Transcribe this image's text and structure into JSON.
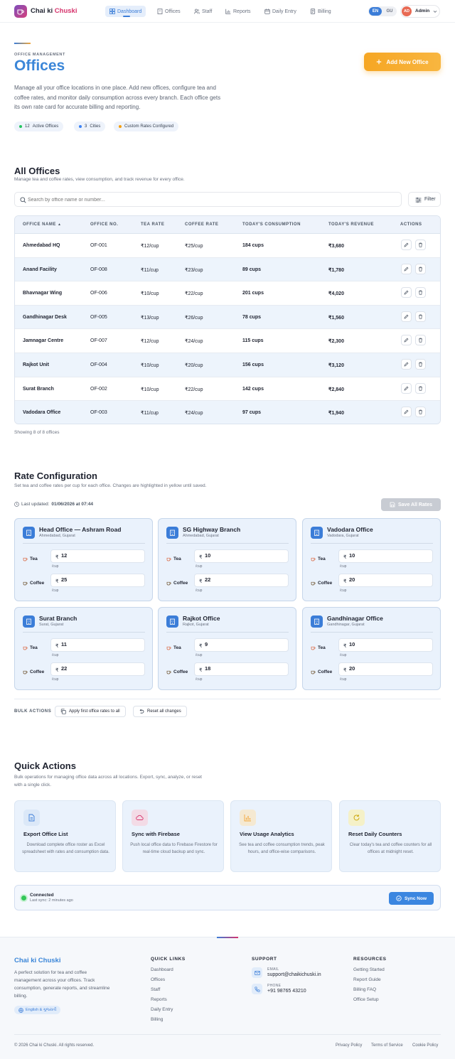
{
  "nav": {
    "brand_part1": "Chai ki",
    "brand_part2": "Chuski",
    "items": [
      {
        "label": "Dashboard",
        "icon": "grid-icon",
        "active": true
      },
      {
        "label": "Offices",
        "icon": "building-icon"
      },
      {
        "label": "Staff",
        "icon": "users-icon"
      },
      {
        "label": "Reports",
        "icon": "chart-icon"
      },
      {
        "label": "Daily Entry",
        "icon": "calendar-icon"
      },
      {
        "label": "Billing",
        "icon": "receipt-icon"
      }
    ],
    "lang_en": "EN",
    "lang_gu": "GU",
    "avatar_initials": "AD",
    "user_name": "Admin"
  },
  "hero": {
    "eyebrow": "OFFICE MANAGEMENT",
    "title": "Offices",
    "description": "Manage all your office locations in one place. Add new offices, configure tea and coffee rates, and monitor daily consumption across every branch. Each office gets its own rate card for accurate billing and reporting.",
    "chips": [
      {
        "value": "12",
        "label": "Active Offices",
        "color": "#22c55e"
      },
      {
        "value": "3",
        "label": "Cities",
        "color": "#3b82f6"
      },
      {
        "value": "",
        "label": "Custom Rates Configured",
        "color": "#f59e0b"
      }
    ],
    "add_button": "Add New Office"
  },
  "offices": {
    "title": "All Offices",
    "subtitle": "Manage tea and coffee rates, view consumption, and track revenue for every office.",
    "search_placeholder": "Search by office name or number...",
    "filter_label": "Filter",
    "columns": [
      "OFFICE NAME",
      "OFFICE NO.",
      "TEA RATE",
      "COFFEE RATE",
      "TODAY'S CONSUMPTION",
      "TODAY'S REVENUE",
      "ACTIONS"
    ],
    "rows": [
      {
        "name": "Ahmedabad HQ",
        "no": "OF-001",
        "tea": "₹12/cup",
        "coffee": "₹25/cup",
        "consumption": "184 cups",
        "revenue": "₹3,680"
      },
      {
        "name": "Anand Facility",
        "no": "OF-008",
        "tea": "₹11/cup",
        "coffee": "₹23/cup",
        "consumption": "89 cups",
        "revenue": "₹1,780"
      },
      {
        "name": "Bhavnagar Wing",
        "no": "OF-006",
        "tea": "₹10/cup",
        "coffee": "₹22/cup",
        "consumption": "201 cups",
        "revenue": "₹4,020"
      },
      {
        "name": "Gandhinagar Desk",
        "no": "OF-005",
        "tea": "₹13/cup",
        "coffee": "₹26/cup",
        "consumption": "78 cups",
        "revenue": "₹1,560"
      },
      {
        "name": "Jamnagar Centre",
        "no": "OF-007",
        "tea": "₹12/cup",
        "coffee": "₹24/cup",
        "consumption": "115 cups",
        "revenue": "₹2,300"
      },
      {
        "name": "Rajkot Unit",
        "no": "OF-004",
        "tea": "₹10/cup",
        "coffee": "₹20/cup",
        "consumption": "156 cups",
        "revenue": "₹3,120"
      },
      {
        "name": "Surat Branch",
        "no": "OF-002",
        "tea": "₹10/cup",
        "coffee": "₹22/cup",
        "consumption": "142 cups",
        "revenue": "₹2,840"
      },
      {
        "name": "Vadodara Office",
        "no": "OF-003",
        "tea": "₹11/cup",
        "coffee": "₹24/cup",
        "consumption": "97 cups",
        "revenue": "₹1,940"
      }
    ],
    "showing": "Showing 8 of 8 offices"
  },
  "rates": {
    "title": "Rate Configuration",
    "subtitle": "Set tea and coffee rates per cup for each office. Changes are highlighted in yellow until saved.",
    "last_updated_label": "Last updated:",
    "last_updated_value": "01/06/2026 at 07:44",
    "save_button": "Save All Rates",
    "tea_label": "Tea",
    "coffee_label": "Coffee",
    "currency": "₹",
    "unit": "/cup",
    "cards": [
      {
        "name": "Head Office — Ashram Road",
        "location": "Ahmedabad, Gujarat",
        "tea": "12",
        "coffee": "25"
      },
      {
        "name": "SG Highway Branch",
        "location": "Ahmedabad, Gujarat",
        "tea": "10",
        "coffee": "22"
      },
      {
        "name": "Vadodara Office",
        "location": "Vadodara, Gujarat",
        "tea": "10",
        "coffee": "20"
      },
      {
        "name": "Surat Branch",
        "location": "Surat, Gujarat",
        "tea": "11",
        "coffee": "22"
      },
      {
        "name": "Rajkot Office",
        "location": "Rajkot, Gujarat",
        "tea": "9",
        "coffee": "18"
      },
      {
        "name": "Gandhinagar Office",
        "location": "Gandhinagar, Gujarat",
        "tea": "10",
        "coffee": "20"
      }
    ],
    "bulk_label": "BULK ACTIONS",
    "bulk_apply": "Apply first office rates to all",
    "bulk_reset": "Reset all changes"
  },
  "quick": {
    "title": "Quick Actions",
    "subtitle": "Bulk operations for managing office data across all locations. Export, sync, analyze, or reset with a single click.",
    "cards": [
      {
        "title": "Export Office List",
        "desc": "Download complete office roster as Excel spreadsheet with rates and consumption data.",
        "icon": "file-icon",
        "bg": "#dbe8f8",
        "fg": "#3b7dd8"
      },
      {
        "title": "Sync with Firebase",
        "desc": "Push local office data to Firebase Firestore for real-time cloud backup and sync.",
        "icon": "cloud-icon",
        "bg": "#f3dbe6",
        "fg": "#d6336c"
      },
      {
        "title": "View Usage Analytics",
        "desc": "See tea and coffee consumption trends, peak hours, and office-wise comparisons.",
        "icon": "bar-chart-icon",
        "bg": "#f5e9d2",
        "fg": "#f2a73b"
      },
      {
        "title": "Reset Daily Counters",
        "desc": "Clear today's tea and coffee counters for all offices at midnight reset.",
        "icon": "refresh-icon",
        "bg": "#f5f1c8",
        "fg": "#c9a200"
      }
    ],
    "status_title": "Connected",
    "status_sub": "Last sync: 2 minutes ago",
    "sync_button": "Sync Now"
  },
  "footer": {
    "brand": "Chai ki Chuski",
    "description": "A perfect solution for tea and coffee management across your offices. Track consumption, generate reports, and streamline billing.",
    "lang_pill": "English & ગુજરાતી",
    "quick_links_title": "QUICK LINKS",
    "quick_links": [
      "Dashboard",
      "Offices",
      "Staff",
      "Reports",
      "Daily Entry",
      "Billing"
    ],
    "support_title": "SUPPORT",
    "email_label": "EMAIL",
    "email": "support@chaikichuski.in",
    "phone_label": "PHONE",
    "phone": "+91 98765 43210",
    "resources_title": "RESOURCES",
    "resources": [
      "Getting Started",
      "Report Guide",
      "Billing FAQ",
      "Office Setup"
    ],
    "copyright": "© 2026 Chai ki Chuski. All rights reserved.",
    "legal": [
      "Privacy Policy",
      "Terms of Service",
      "Cookie Policy"
    ]
  }
}
